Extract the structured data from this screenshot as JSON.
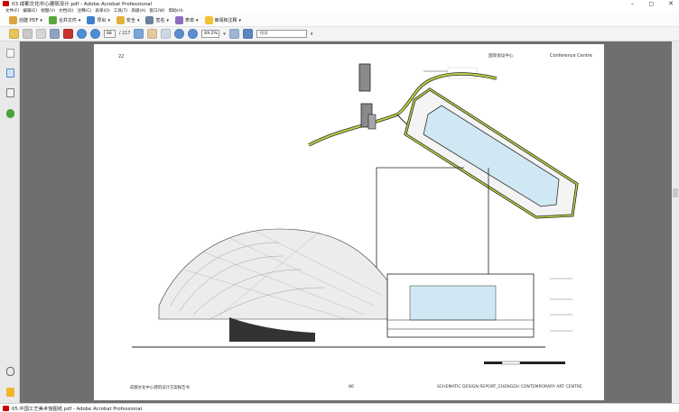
{
  "window": {
    "title": "03.成都文化中心建筑设计.pdf - Adobe Acrobat Professional",
    "controls": {
      "minimize": "–",
      "maximize": "◻",
      "close": "✕"
    }
  },
  "menu": [
    "文件(F)",
    "编辑(E)",
    "视图(V)",
    "文档(D)",
    "注释(C)",
    "表单(O)",
    "工具(T)",
    "高级(A)",
    "窗口(W)",
    "帮助(H)"
  ],
  "toolbar": {
    "create_pdf": "创建 PDF",
    "combine": "合并文件",
    "export": "导出",
    "secure": "安全",
    "sign": "签名",
    "forms": "表单",
    "review": "审阅和注释",
    "dropdown": "▾"
  },
  "nav": {
    "current_page": "88",
    "total_pages": "/ 217",
    "zoom": "69.2%",
    "search_placeholder": "搜索"
  },
  "page": {
    "number": "22",
    "header_cn": "国际会议中心",
    "header_en": "Conference Centre",
    "footer_cn": "成都文化中心建筑设计方案报告书",
    "footer_page": "86",
    "footer_en": "SCHEMATIC DESIGN REPORT_CHENGDU CONTEMPORARY ART CENTRE"
  },
  "taskbar": {
    "title": "05.中国工艺美术馆图纸.pdf - Adobe Acrobat Professional"
  },
  "colors": {
    "accent_green": "#b9d542",
    "glass_blue": "#cfe8f3",
    "workspace": "#6f6f6f"
  }
}
